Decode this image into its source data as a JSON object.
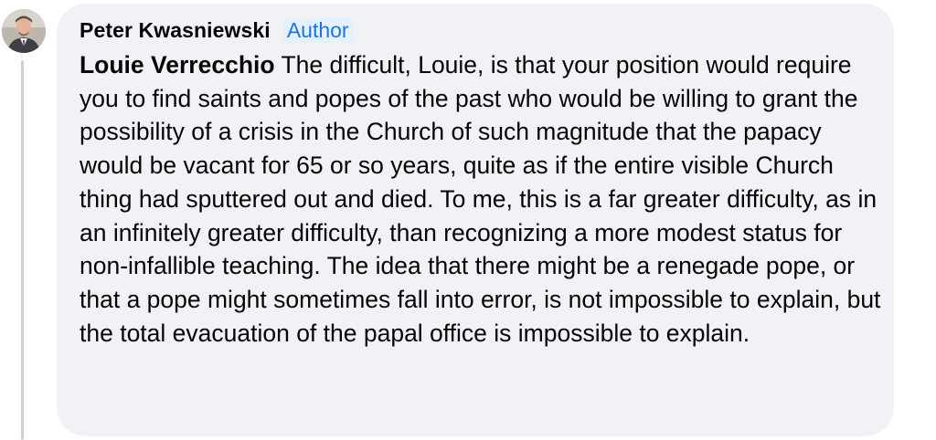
{
  "comment": {
    "author": "Peter Kwasniewski",
    "badge": "Author",
    "mention": "Louie Verrecchio",
    "text": "The difficult, Louie, is that your position would require you to find saints and popes of the past who would be willing to grant the possibility of a crisis in the Church of such magnitude that the papacy would be vacant for 65 or so years, quite as if the entire visible Church thing had sputtered out and died. To me, this is a far greater difficulty, as in an infinitely greater difficulty, than recognizing a more modest status for non-infallible teaching. The idea that there might be a renegade pope, or that a pope might sometimes fall into error, is not impossible to explain, but the total evacuation of the papal office is impossible to explain."
  },
  "colors": {
    "bubble_bg": "#f0f2f5",
    "badge_text": "#1b74e4",
    "badge_bg": "#e7f0fd",
    "text": "#050505"
  }
}
